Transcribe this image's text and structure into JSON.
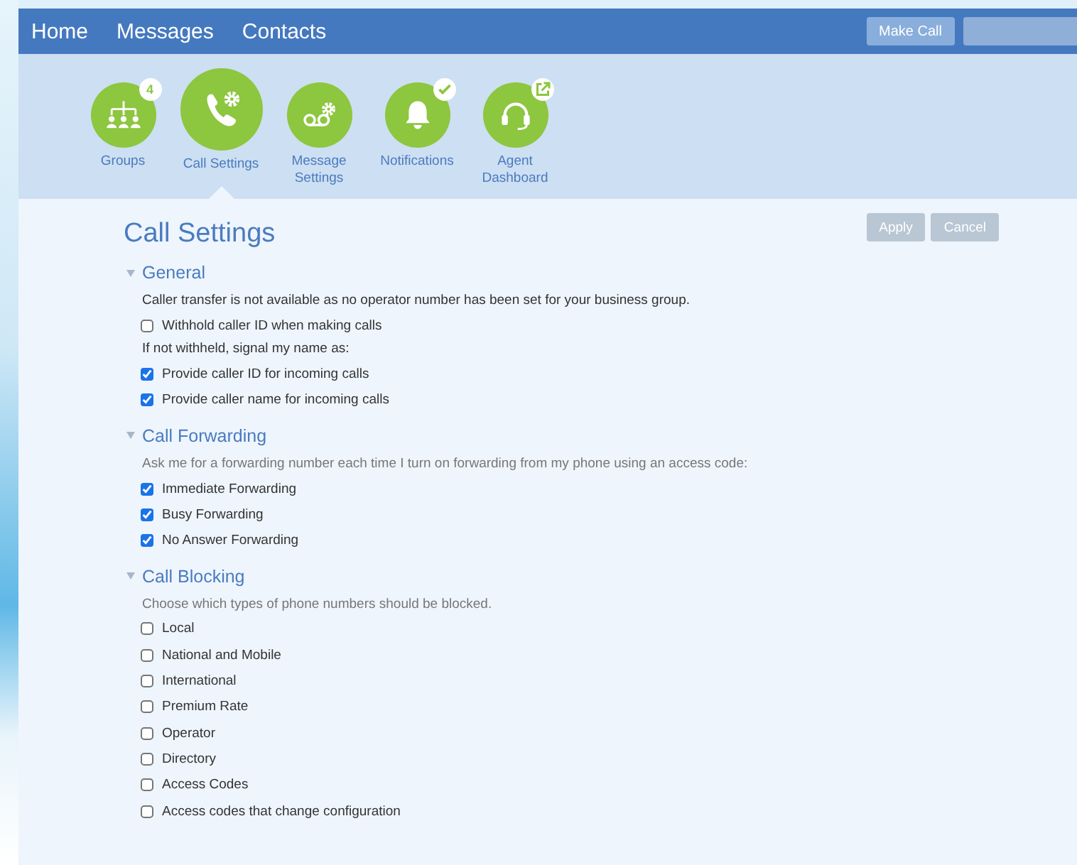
{
  "nav": {
    "links": [
      "Home",
      "Messages",
      "Contacts"
    ],
    "make_call": "Make Call"
  },
  "tabs": [
    {
      "kind": "groups",
      "label": "Groups",
      "selected": false,
      "badge": {
        "kind": "count",
        "text": "4"
      }
    },
    {
      "kind": "call",
      "label": "Call Settings",
      "selected": true
    },
    {
      "kind": "voicemail",
      "label": "Message Settings",
      "selected": false
    },
    {
      "kind": "bell",
      "label": "Notifications",
      "selected": false,
      "badge": {
        "kind": "check"
      }
    },
    {
      "kind": "headset",
      "label": "Agent Dashboard",
      "selected": false,
      "badge": {
        "kind": "external"
      }
    }
  ],
  "page": {
    "title": "Call Settings",
    "buttons": [
      {
        "label": "Apply",
        "disabled": true
      },
      {
        "label": "Cancel",
        "disabled": true
      }
    ]
  },
  "sections": [
    {
      "title": "General",
      "expanded": true,
      "items": [
        {
          "kind": "note",
          "text": "Caller transfer is not available as no operator number has been set for your business group.",
          "muted": false
        },
        {
          "kind": "checkbox",
          "text": "Withhold caller ID when making calls",
          "checked": false
        },
        {
          "kind": "note",
          "text": "If not withheld, signal my name as:",
          "muted": false
        },
        {
          "kind": "checkbox",
          "text": "Provide caller ID for incoming calls",
          "checked": true
        },
        {
          "kind": "checkbox",
          "text": "Provide caller name for incoming calls",
          "checked": true
        }
      ]
    },
    {
      "title": "Call Forwarding",
      "expanded": true,
      "items": [
        {
          "kind": "note",
          "text": "Ask me for a forwarding number each time I turn on forwarding from my phone using an access code:",
          "muted": true
        },
        {
          "kind": "checkbox",
          "text": "Immediate Forwarding",
          "checked": true
        },
        {
          "kind": "checkbox",
          "text": "Busy Forwarding",
          "checked": true
        },
        {
          "kind": "checkbox",
          "text": "No Answer Forwarding",
          "checked": true
        }
      ]
    },
    {
      "title": "Call Blocking",
      "expanded": true,
      "items": [
        {
          "kind": "note",
          "text": "Choose which types of phone numbers should be blocked.",
          "muted": true
        },
        {
          "kind": "checkbox",
          "text": "Local",
          "checked": false
        },
        {
          "kind": "checkbox",
          "text": "National and Mobile",
          "checked": false
        },
        {
          "kind": "checkbox",
          "text": "International",
          "checked": false
        },
        {
          "kind": "checkbox",
          "text": "Premium Rate",
          "checked": false
        },
        {
          "kind": "checkbox",
          "text": "Operator",
          "checked": false
        },
        {
          "kind": "checkbox",
          "text": "Directory",
          "checked": false
        },
        {
          "kind": "checkbox",
          "text": "Access Codes",
          "checked": false
        },
        {
          "kind": "checkbox",
          "text": "Access codes that change configuration",
          "checked": false
        }
      ]
    }
  ]
}
